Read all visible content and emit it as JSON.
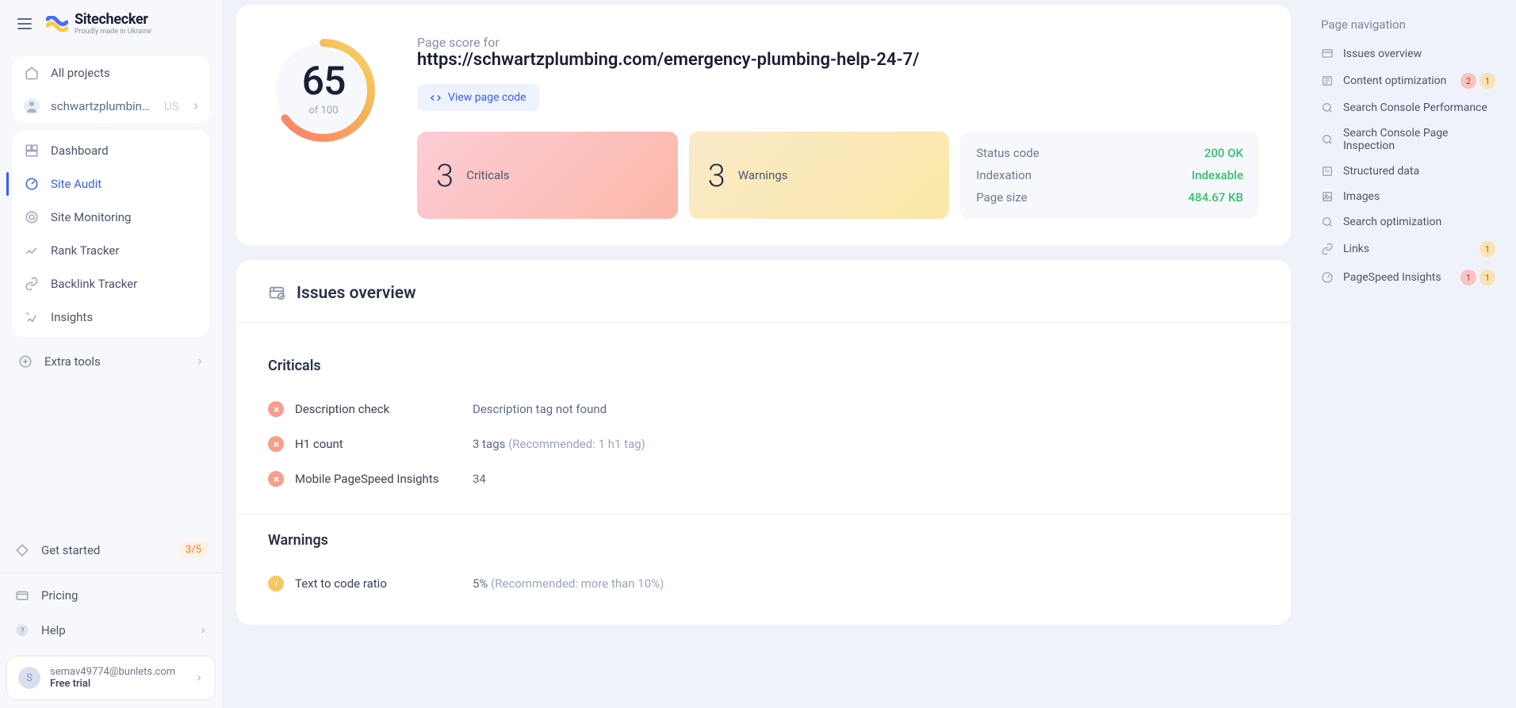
{
  "brand": {
    "title": "Sitechecker",
    "subtitle": "Proudly made in Ukraine"
  },
  "sidebar": {
    "all_projects": "All projects",
    "current_project": "schwartzplumbin…",
    "project_code": "US",
    "items": [
      {
        "label": "Dashboard"
      },
      {
        "label": "Site Audit"
      },
      {
        "label": "Site Monitoring"
      },
      {
        "label": "Rank Tracker"
      },
      {
        "label": "Backlink Tracker"
      },
      {
        "label": "Insights"
      }
    ],
    "extra_tools": "Extra tools",
    "get_started": "Get started",
    "get_started_ratio": "3/5",
    "pricing": "Pricing",
    "help": "Help"
  },
  "user": {
    "avatar_letter": "S",
    "email": "semav49774@bunlets.com",
    "plan": "Free trial"
  },
  "score": {
    "label": "Page score for",
    "url": "https://schwartzplumbing.com/emergency-plumbing-help-24-7/",
    "value": "65",
    "of": "of 100",
    "view_code": "View page code",
    "criticals_count": "3",
    "criticals_label": "Criticals",
    "warnings_count": "3",
    "warnings_label": "Warnings",
    "meta": [
      {
        "key": "Status code",
        "val": "200 OK"
      },
      {
        "key": "Indexation",
        "val": "Indexable"
      },
      {
        "key": "Page size",
        "val": "484.67 KB"
      }
    ]
  },
  "issues": {
    "title": "Issues overview",
    "criticals_title": "Criticals",
    "warnings_title": "Warnings",
    "criticals": [
      {
        "name": "Description check",
        "desc": "Description tag not found",
        "hint": ""
      },
      {
        "name": "H1 count",
        "desc": "3 tags ",
        "hint": "(Recommended: 1 h1 tag)"
      },
      {
        "name": "Mobile PageSpeed Insights",
        "desc": "34",
        "hint": ""
      }
    ],
    "warnings": [
      {
        "name": "Text to code ratio",
        "desc": "5%   ",
        "hint": "(Recommended: more than 10%)"
      }
    ]
  },
  "right": {
    "title": "Page navigation",
    "items": [
      {
        "label": "Issues overview",
        "badges": []
      },
      {
        "label": "Content optimization",
        "badges": [
          {
            "type": "pink",
            "val": "2"
          },
          {
            "type": "yellow",
            "val": "1"
          }
        ]
      },
      {
        "label": "Search Console Performance",
        "badges": []
      },
      {
        "label": "Search Console Page Inspection",
        "badges": []
      },
      {
        "label": "Structured data",
        "badges": []
      },
      {
        "label": "Images",
        "badges": []
      },
      {
        "label": "Search optimization",
        "badges": []
      },
      {
        "label": "Links",
        "badges": [
          {
            "type": "yellow",
            "val": "1"
          }
        ]
      },
      {
        "label": "PageSpeed Insights",
        "badges": [
          {
            "type": "pink",
            "val": "1"
          },
          {
            "type": "yellow",
            "val": "1"
          }
        ]
      }
    ]
  }
}
